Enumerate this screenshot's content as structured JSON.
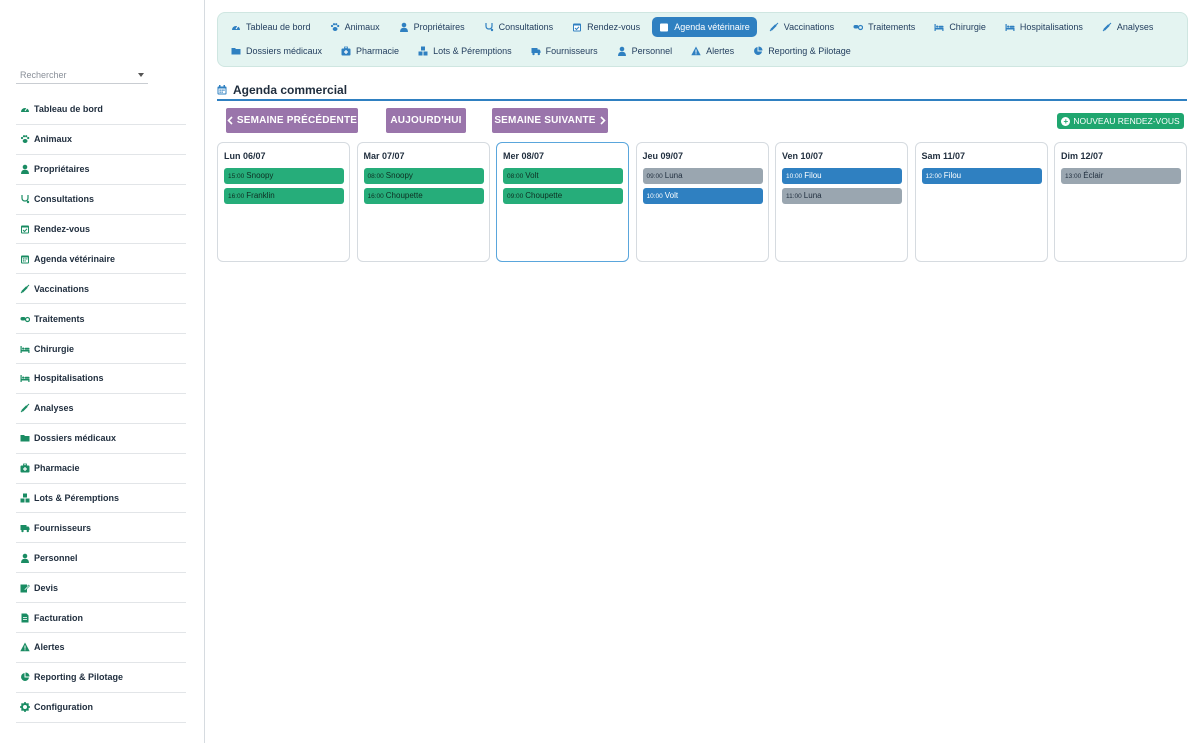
{
  "search": {
    "placeholder": "Rechercher"
  },
  "sidebar": {
    "items": [
      {
        "label": "Tableau de bord",
        "icon": "gauge-icon"
      },
      {
        "label": "Animaux",
        "icon": "paw-icon"
      },
      {
        "label": "Propriétaires",
        "icon": "user-icon"
      },
      {
        "label": "Consultations",
        "icon": "stethoscope-icon"
      },
      {
        "label": "Rendez-vous",
        "icon": "calendar-check-icon"
      },
      {
        "label": "Agenda vétérinaire",
        "icon": "calendar-icon"
      },
      {
        "label": "Vaccinations",
        "icon": "syringe-icon"
      },
      {
        "label": "Traitements",
        "icon": "pills-icon"
      },
      {
        "label": "Chirurgie",
        "icon": "bed-icon"
      },
      {
        "label": "Hospitalisations",
        "icon": "bed-icon"
      },
      {
        "label": "Analyses",
        "icon": "syringe-icon"
      },
      {
        "label": "Dossiers médicaux",
        "icon": "folder-icon"
      },
      {
        "label": "Pharmacie",
        "icon": "medkit-icon"
      },
      {
        "label": "Lots & Péremptions",
        "icon": "boxes-icon"
      },
      {
        "label": "Fournisseurs",
        "icon": "truck-icon"
      },
      {
        "label": "Personnel",
        "icon": "user-icon"
      },
      {
        "label": "Devis",
        "icon": "edit-icon"
      },
      {
        "label": "Facturation",
        "icon": "invoice-icon"
      },
      {
        "label": "Alertes",
        "icon": "warning-icon"
      },
      {
        "label": "Reporting & Pilotage",
        "icon": "pie-chart-icon"
      },
      {
        "label": "Configuration",
        "icon": "gear-icon"
      }
    ]
  },
  "topnav": {
    "row1": [
      {
        "label": "Tableau de bord",
        "icon": "gauge-icon"
      },
      {
        "label": "Animaux",
        "icon": "paw-icon"
      },
      {
        "label": "Propriétaires",
        "icon": "user-icon"
      },
      {
        "label": "Consultations",
        "icon": "stethoscope-icon"
      },
      {
        "label": "Rendez-vous",
        "icon": "calendar-check-icon"
      },
      {
        "label": "Agenda vétérinaire",
        "icon": "calendar-icon",
        "active": true
      },
      {
        "label": "Vaccinations",
        "icon": "syringe-icon"
      },
      {
        "label": "Traitements",
        "icon": "pills-icon"
      },
      {
        "label": "Chirurgie",
        "icon": "bed-icon"
      },
      {
        "label": "Hospitalisations",
        "icon": "bed-icon"
      },
      {
        "label": "Analyses",
        "icon": "syringe-icon"
      }
    ],
    "row2": [
      {
        "label": "Dossiers médicaux",
        "icon": "folder-icon"
      },
      {
        "label": "Pharmacie",
        "icon": "medkit-icon"
      },
      {
        "label": "Lots & Péremptions",
        "icon": "boxes-icon"
      },
      {
        "label": "Fournisseurs",
        "icon": "truck-icon"
      },
      {
        "label": "Personnel",
        "icon": "user-icon"
      },
      {
        "label": "Alertes",
        "icon": "warning-icon"
      },
      {
        "label": "Reporting & Pilotage",
        "icon": "pie-chart-icon"
      }
    ]
  },
  "page": {
    "title": "Agenda commercial"
  },
  "buttons": {
    "prev": "SEMAINE PRÉCÉDENTE",
    "today": "AUJOURD'HUI",
    "next": "SEMAINE SUIVANTE",
    "new": "NOUVEAU RENDEZ-VOUS"
  },
  "colors": {
    "accent": "#2f80c1",
    "green": "#26ad7a",
    "grey": "#9aa6b0",
    "purple": "#9a75ab",
    "new_button": "#1fa66f"
  },
  "days": [
    {
      "label": "Lun 06/07",
      "appointments": [
        {
          "time": "15:00",
          "name": "Snoopy",
          "status": "green"
        },
        {
          "time": "16:00",
          "name": "Franklin",
          "status": "green"
        }
      ]
    },
    {
      "label": "Mar 07/07",
      "appointments": [
        {
          "time": "08:00",
          "name": "Snoopy",
          "status": "green"
        },
        {
          "time": "16:00",
          "name": "Choupette",
          "status": "green"
        }
      ]
    },
    {
      "label": "Mer 08/07",
      "today": true,
      "appointments": [
        {
          "time": "08:00",
          "name": "Volt",
          "status": "green"
        },
        {
          "time": "09:00",
          "name": "Choupette",
          "status": "green"
        }
      ]
    },
    {
      "label": "Jeu 09/07",
      "appointments": [
        {
          "time": "09:00",
          "name": "Luna",
          "status": "grey"
        },
        {
          "time": "10:00",
          "name": "Volt",
          "status": "blue"
        }
      ]
    },
    {
      "label": "Ven 10/07",
      "appointments": [
        {
          "time": "10:00",
          "name": "Filou",
          "status": "blue"
        },
        {
          "time": "11:00",
          "name": "Luna",
          "status": "grey"
        }
      ]
    },
    {
      "label": "Sam 11/07",
      "appointments": [
        {
          "time": "12:00",
          "name": "Filou",
          "status": "blue"
        }
      ]
    },
    {
      "label": "Dim 12/07",
      "appointments": [
        {
          "time": "13:00",
          "name": "Éclair",
          "status": "grey"
        }
      ]
    }
  ]
}
